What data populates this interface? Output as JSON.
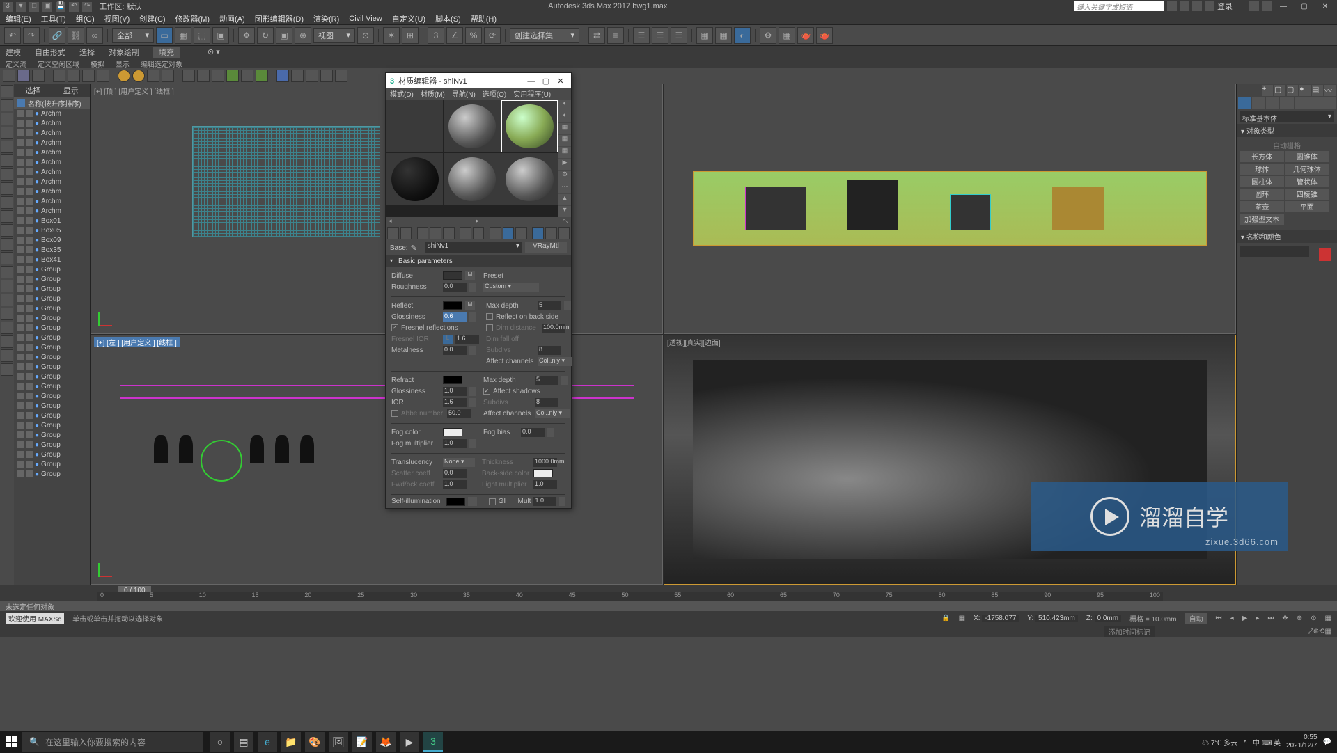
{
  "app": {
    "workspace_label": "工作区: 默认",
    "title": "Autodesk 3ds Max 2017    bwg1.max",
    "search_placeholder": "键入关键字或短语",
    "login": "登录"
  },
  "menubar": [
    "编辑(E)",
    "工具(T)",
    "组(G)",
    "视图(V)",
    "创建(C)",
    "修改器(M)",
    "动画(A)",
    "图形编辑器(D)",
    "渲染(R)",
    "Civil View",
    "自定义(U)",
    "脚本(S)",
    "帮助(H)"
  ],
  "main_toolbar": {
    "dd_all": "全部",
    "dd_view": "视图",
    "dd_selset": "创建选择集"
  },
  "ribbon_tabs": [
    "建模",
    "自由形式",
    "选择",
    "对象绘制",
    "填充"
  ],
  "ribbon_sub": [
    "定义流",
    "定义空闲区域",
    "模拟",
    "显示",
    "编辑选定对象"
  ],
  "scene_explorer": {
    "tab_select": "选择",
    "tab_display": "显示",
    "sort_label": "名称(按升序排序)",
    "items": [
      "Archm",
      "Archm",
      "Archm",
      "Archm",
      "Archm",
      "Archm",
      "Archm",
      "Archm",
      "Archm",
      "Archm",
      "Archm",
      "Box01",
      "Box05",
      "Box09",
      "Box35",
      "Box41",
      "Group",
      "Group",
      "Group",
      "Group",
      "Group",
      "Group",
      "Group",
      "Group",
      "Group",
      "Group",
      "Group",
      "Group",
      "Group",
      "Group",
      "Group",
      "Group",
      "Group",
      "Group",
      "Group",
      "Group",
      "Group",
      "Group"
    ]
  },
  "viewports": {
    "v1_label": "[+] [顶 ] [用户定义 ] [线框 ]",
    "v3_label": "[+] [左 ] [用户定义 ] [线框 ]",
    "v4_label": "[透视][真实][边面]"
  },
  "command_panel": {
    "dd_category": "标准基本体",
    "roll_objtype": "对象类型",
    "auto_grid": "自动栅格",
    "buttons": [
      "长方体",
      "圆锥体",
      "球体",
      "几何球体",
      "圆柱体",
      "管状体",
      "圆环",
      "四棱锥",
      "茶壶",
      "平面",
      "加强型文本"
    ],
    "roll_name_color": "名称和颜色"
  },
  "mat_editor": {
    "title": "材质编辑器 - shiNv1",
    "menu": [
      "模式(D)",
      "材质(M)",
      "导航(N)",
      "选项(O)",
      "实用程序(U)"
    ],
    "base_label": "Base:",
    "mat_name": "shiNv1",
    "mat_type": "VRayMtl",
    "roll_basic": "Basic parameters",
    "params": {
      "diffuse": "Diffuse",
      "roughness": "Roughness",
      "roughness_val": "0.0",
      "preset": "Preset",
      "preset_val": "Custom",
      "reflect": "Reflect",
      "glossiness": "Glossiness",
      "glossiness_val": "0.6",
      "fresnel": "Fresnel reflections",
      "fresnel_ior": "Fresnel IOR",
      "fresnel_ior_val": "1.6",
      "metalness": "Metalness",
      "metalness_val": "0.0",
      "max_depth": "Max depth",
      "max_depth_val": "5",
      "reflect_back": "Reflect on back side",
      "dim_distance": "Dim distance",
      "dim_distance_val": "100.0mm",
      "dim_falloff": "Dim fall off",
      "subdivs": "Subdivs",
      "subdivs_val": "8",
      "affect_ch": "Affect channels",
      "affect_ch_val": "Col..nly",
      "refract": "Refract",
      "refr_gloss": "Glossiness",
      "refr_gloss_val": "1.0",
      "ior": "IOR",
      "ior_val": "1.6",
      "abbe": "Abbe number",
      "abbe_val": "50.0",
      "refr_maxdepth": "Max depth",
      "refr_maxdepth_val": "5",
      "affect_shadows": "Affect shadows",
      "refr_subdivs": "Subdivs",
      "refr_subdivs_val": "8",
      "fog_color": "Fog color",
      "fog_mult": "Fog multiplier",
      "fog_mult_val": "1.0",
      "fog_bias": "Fog bias",
      "fog_bias_val": "0.0",
      "translucency": "Translucency",
      "translucency_val": "None",
      "scatter": "Scatter coeff",
      "scatter_val": "0.0",
      "fwdbck": "Fwd/bck coeff",
      "fwdbck_val": "1.0",
      "thickness": "Thickness",
      "thickness_val": "1000.0mm",
      "backside": "Back-side color",
      "lightmult": "Light multiplier",
      "lightmult_val": "1.0",
      "selfillum": "Self-illumination",
      "gi": "GI",
      "mult": "Mult",
      "mult_val": "1.0",
      "m_btn": "M",
      "l_btn": "L"
    }
  },
  "timeline": {
    "frame": "0 / 100",
    "ticks": [
      "0",
      "5",
      "10",
      "15",
      "20",
      "25",
      "30",
      "35",
      "40",
      "45",
      "50",
      "55",
      "60",
      "65",
      "70",
      "75",
      "80",
      "85",
      "90",
      "95",
      "100"
    ]
  },
  "status": {
    "prompt1": "未选定任何对象",
    "prompt2": "单击或单击并拖动以选择对象",
    "welcome": "欢迎使用 MAXSc",
    "x_lbl": "X:",
    "x_val": "-1758.077",
    "y_lbl": "Y:",
    "y_val": "510.423mm",
    "z_lbl": "Z:",
    "z_val": "0.0mm",
    "grid": "栅格 = 10.0mm",
    "autokey": "自动",
    "addtime": "添加时间标记"
  },
  "watermark": {
    "text": "溜溜自学",
    "url": "zixue.3d66.com"
  },
  "taskbar": {
    "search_ph": "在这里输入你要搜索的内容",
    "weather": "7℃ 多云",
    "ime": "中 ⌨ 英",
    "time": "0:55",
    "date": "2021/12/7"
  }
}
